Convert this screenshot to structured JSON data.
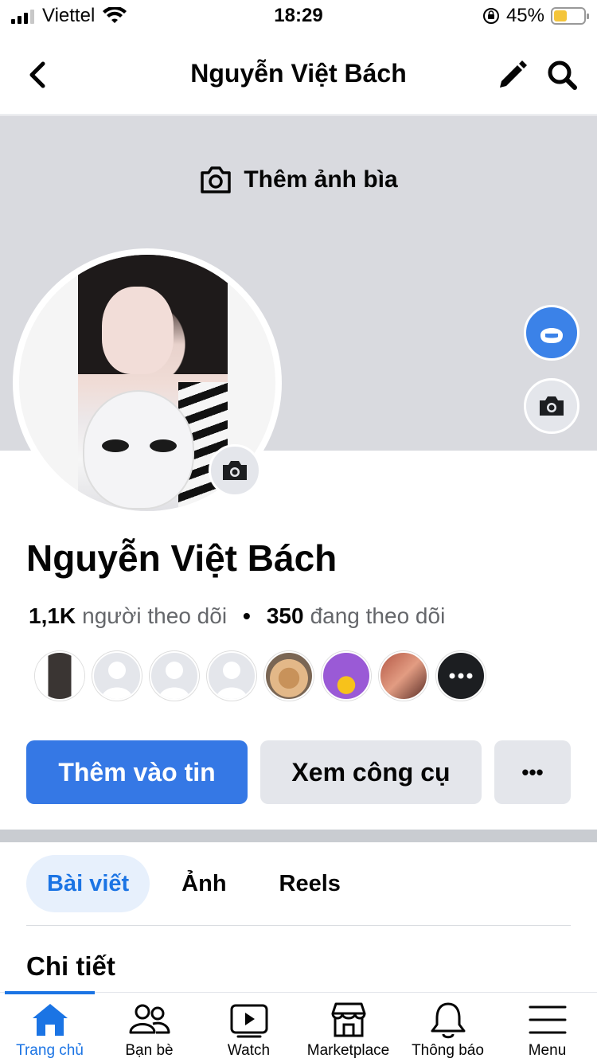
{
  "status_bar": {
    "carrier": "Viettel",
    "time": "18:29",
    "battery": "45%",
    "battery_level": 0.45
  },
  "header": {
    "title": "Nguyễn Việt Bách"
  },
  "cover": {
    "add_cover_label": "Thêm ảnh bìa"
  },
  "profile": {
    "name": "Nguyễn Việt Bách",
    "followers_count": "1,1K",
    "followers_label": "người theo dõi",
    "separator": "•",
    "following_count": "350",
    "following_label": "đang theo dõi"
  },
  "actions": {
    "add_to_story": "Thêm vào tin",
    "view_tools": "Xem công cụ",
    "more": "•••"
  },
  "tabs": [
    {
      "label": "Bài viết",
      "active": true
    },
    {
      "label": "Ảnh",
      "active": false
    },
    {
      "label": "Reels",
      "active": false
    }
  ],
  "details": {
    "title": "Chi tiết"
  },
  "bottom_nav": [
    {
      "label": "Trang chủ",
      "icon": "home-icon",
      "active": true
    },
    {
      "label": "Bạn bè",
      "icon": "friends-icon",
      "active": false
    },
    {
      "label": "Watch",
      "icon": "watch-icon",
      "active": false
    },
    {
      "label": "Marketplace",
      "icon": "marketplace-icon",
      "active": false
    },
    {
      "label": "Thông báo",
      "icon": "bell-icon",
      "active": false
    },
    {
      "label": "Menu",
      "icon": "menu-icon",
      "active": false
    }
  ],
  "colors": {
    "accent": "#1b74e4",
    "primary_button": "#3578e5",
    "cover": "#d9dadf"
  }
}
